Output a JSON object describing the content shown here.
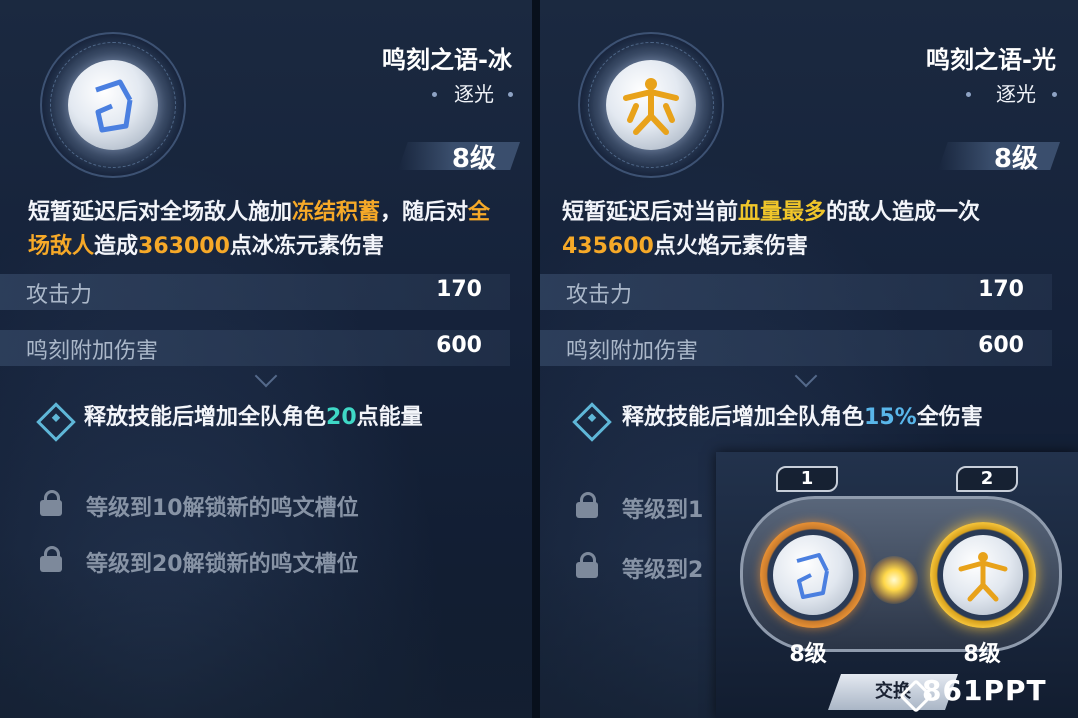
{
  "left": {
    "name": "鸣刻之语-冰",
    "subtitle": "逐光",
    "level": "8级",
    "desc": {
      "p1": "短暂延迟后对全场敌人施加",
      "h1": "冻结积蓄",
      "p2": "，随后对",
      "h2": "全场敌人",
      "p3": "造成",
      "h3": "363000",
      "p4": "点冰冻元素伤害"
    },
    "stats": [
      {
        "label": "攻击力",
        "value": "170"
      },
      {
        "label": "鸣刻附加伤害",
        "value": "600"
      }
    ],
    "bonus": {
      "p1": "释放技能后增加全队角色",
      "h": "20",
      "p2": "点能量"
    },
    "locks": [
      "等级到10解锁新的鸣文槽位",
      "等级到20解锁新的鸣文槽位"
    ]
  },
  "right": {
    "name": "鸣刻之语-光",
    "subtitle": "逐光",
    "level": "8级",
    "desc": {
      "p1": "短暂延迟后对当前",
      "h1": "血量最多",
      "p2": "的敌人造成一次",
      "h2": "435600",
      "p3": "点火焰元素伤害"
    },
    "stats": [
      {
        "label": "攻击力",
        "value": "170"
      },
      {
        "label": "鸣刻附加伤害",
        "value": "600"
      }
    ],
    "bonus": {
      "p1": "释放技能后增加全队角色",
      "h": "15%",
      "p2": "全伤害"
    },
    "locks": [
      "等级到1",
      "等级到2"
    ]
  },
  "swap": {
    "slot1": "1",
    "slot2": "2",
    "level1": "8级",
    "level2": "8级",
    "button": "交换"
  },
  "watermark": "861PPT",
  "colors": {
    "highlight_orange": "#f6a928",
    "highlight_blue": "#59b6ea",
    "ice_accent": "#4a7fe0",
    "light_accent": "#e8a21a"
  }
}
